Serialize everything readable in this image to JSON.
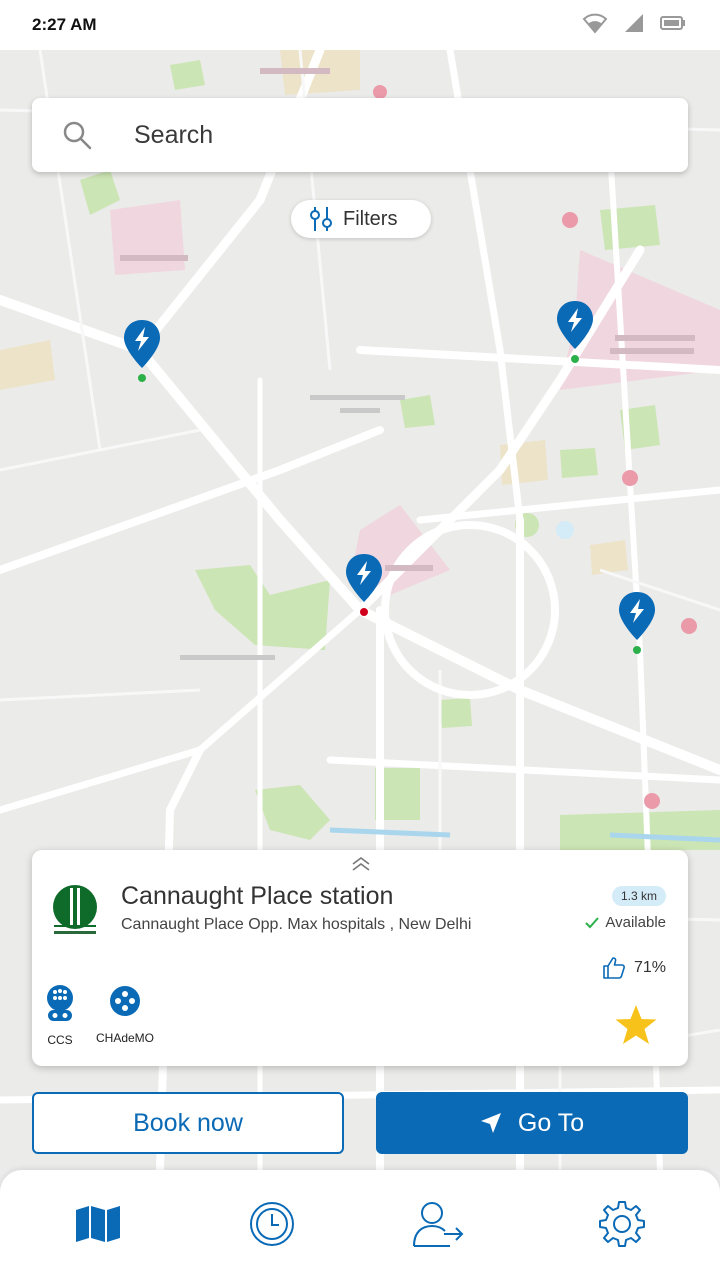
{
  "status_bar": {
    "time": "2:27 AM",
    "icons": [
      "wifi-icon",
      "signal-icon",
      "battery-icon"
    ]
  },
  "search": {
    "placeholder": "Search",
    "icon": "search-icon"
  },
  "filters": {
    "label": "Filters",
    "icon": "sliders-icon"
  },
  "map": {
    "pins": [
      {
        "name": "station-pin-1",
        "status": "green"
      },
      {
        "name": "station-pin-2",
        "status": "green"
      },
      {
        "name": "station-pin-3",
        "status": "red"
      },
      {
        "name": "station-pin-4",
        "status": "green"
      }
    ]
  },
  "station_card": {
    "name": "Cannaught Place station",
    "address": "Cannaught Place Opp. Max hospitals , New Delhi",
    "distance": "1.3 km",
    "status": "Available",
    "rating": "71%",
    "connectors": [
      {
        "label": "CCS",
        "icon": "ccs-connector-icon"
      },
      {
        "label": "CHAdeMO",
        "icon": "chademo-connector-icon"
      }
    ],
    "favorite_icon": "star-icon"
  },
  "actions": {
    "book_label": "Book now",
    "goto_label": "Go To"
  },
  "bottom_nav": [
    {
      "name": "map-icon",
      "active": true
    },
    {
      "name": "history-icon",
      "active": false
    },
    {
      "name": "profile-switch-icon",
      "active": false
    },
    {
      "name": "settings-icon",
      "active": false
    }
  ],
  "colors": {
    "brand_blue": "#0a6ab6",
    "available_green": "#2bb04a",
    "offline_red": "#d0021b",
    "star_yellow": "#f7c31a"
  }
}
